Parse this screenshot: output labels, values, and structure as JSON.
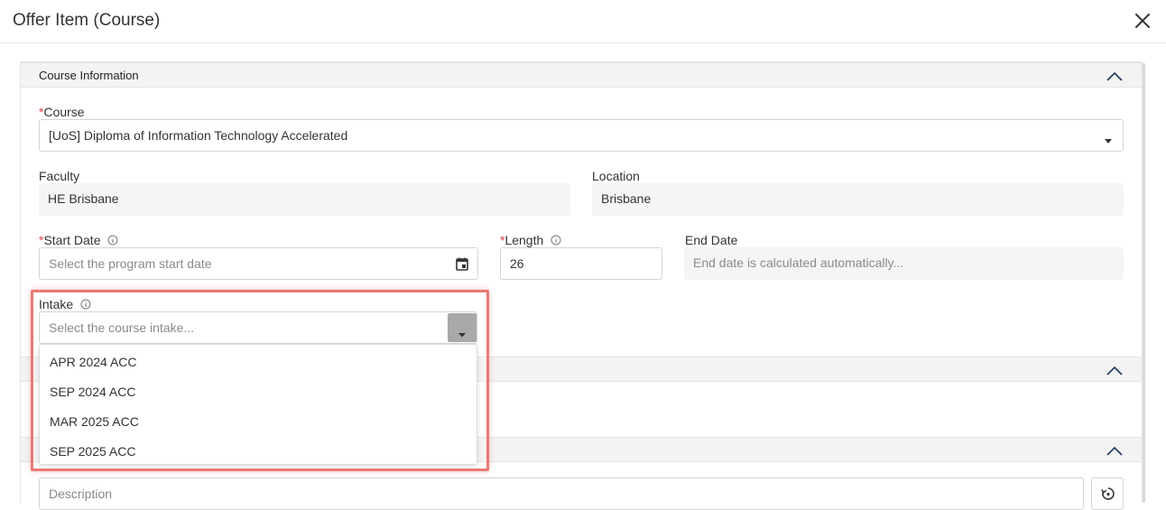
{
  "dialog": {
    "title": "Offer Item (Course)"
  },
  "course_section": {
    "title": "Course Information"
  },
  "course": {
    "required_mark": "*",
    "label": "Course",
    "value": "[UoS] Diploma of Information Technology Accelerated"
  },
  "faculty": {
    "label": "Faculty",
    "value": "HE Brisbane"
  },
  "location": {
    "label": "Location",
    "value": "Brisbane"
  },
  "start_date": {
    "required_mark": "*",
    "label": "Start Date",
    "placeholder": "Select the program start date"
  },
  "length": {
    "required_mark": "*",
    "label": "Length",
    "value": "26"
  },
  "end_date": {
    "label": "End Date",
    "placeholder": "End date is calculated automatically..."
  },
  "intake": {
    "label": "Intake",
    "placeholder": "Select the course intake...",
    "options": [
      "APR 2024 ACC",
      "SEP 2024 ACC",
      "MAR 2025 ACC",
      "SEP 2025 ACC"
    ]
  },
  "description": {
    "placeholder": "Description"
  },
  "colors": {
    "highlight": "#e97a76",
    "required": "#e0413a",
    "section_bg": "#f3f3f3"
  }
}
